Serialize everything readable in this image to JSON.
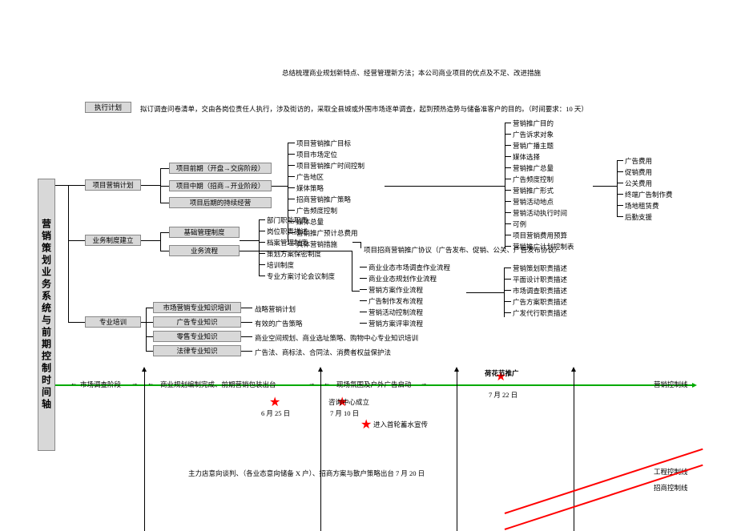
{
  "title": "营销策划业务系统与前期控制时间轴",
  "top": {
    "summary": "总结梳理商业规划新特点、经营管理新方法；本公司商业项目的优点及不足、改进措施",
    "plan_box": "执行计划",
    "plan_text": "拟订调查问卷清单，交由各岗位责任人执行，涉及街访的，采取全县城或外围市场逐单调查，起到预热造势与储备准客户的目的。（时间要求：10 天）"
  },
  "l1": {
    "a": "项目营销计划",
    "b": "业务制度建立",
    "c": "专业培训"
  },
  "l2": {
    "a1": "项目前期（开盘→交房阶段）",
    "a2": "项目中期（招商→开业阶段）",
    "a3": "项目后期的持续经营",
    "b1": "基础管理制度",
    "b2": "业务流程",
    "c1": "市场营销专业知识培训",
    "c2": "广告专业知识",
    "c3": "零售专业知识",
    "c4": "法律专业知识"
  },
  "col3a": [
    "项目营销推广目标",
    "项目市场定位",
    "项目营销推广时间控制",
    "广告地区",
    "媒体策略",
    "招商营销推广策略",
    "广告频度控制",
    "媒体总量",
    "营销推广预计总费用",
    "具体营销措施"
  ],
  "col3a_ext": "项目招商营销推广协议（广告发布、促销、公关、广告发布协议）",
  "col3b": [
    "部门职能职责",
    "岗位职责描述",
    "档案管理制度",
    "策划方案保密制度",
    "培训制度",
    "专业方案讨论会议制度"
  ],
  "col3b2": [
    "商业业态市场调查作业流程",
    "商业业态规划作业流程",
    "营销方案作业流程",
    "广告制作发布流程",
    "营销活动控制流程",
    "营销方案评审流程"
  ],
  "col3c": {
    "c1": "战略营销计划",
    "c2": "有效的广告策略",
    "c3": "商业空间规划、商业选址策略、购物中心专业知识培训",
    "c4": "广告法、商标法、合同法、消费者权益保护法"
  },
  "col4a": [
    "营销推广目的",
    "广告诉求对象",
    "营销广播主题",
    "媒体选择",
    "营销推广总量",
    "广告频度控制",
    "营销推广形式",
    "营销活动地点",
    "营销活动执行时间",
    "可例",
    "项目营销费用预算",
    "营销推广计划控制表"
  ],
  "col4b": [
    "营销策划职责描述",
    "平面设计职责描述",
    "市场调查职责描述",
    "广告方案职责描述",
    "广发代行职责描述"
  ],
  "col5": [
    "广告费用",
    "促销费用",
    "公关费用",
    "终端广告制作费",
    "场地租赁费",
    "后勤支援"
  ],
  "timeline": {
    "p1": "市场调查阶段",
    "p2": "商业规划编制完成、前期营销包装出台",
    "p3": "现场氛围及户外广告启动",
    "p4": "营销控制线",
    "d1": "6 月 25 日",
    "m2": "咨询中心成立",
    "d2": "7 月 10 日",
    "m3": "进入首轮蓄水宣传",
    "m4": "荷花节推广",
    "d4": "7 月 22 日",
    "footer": "主力店意向谈判、（各业态意向储备 X 户）、招商方案与散户策略出台   7 月 20 日",
    "l1": "工程控制线",
    "l2": "招商控制线"
  }
}
